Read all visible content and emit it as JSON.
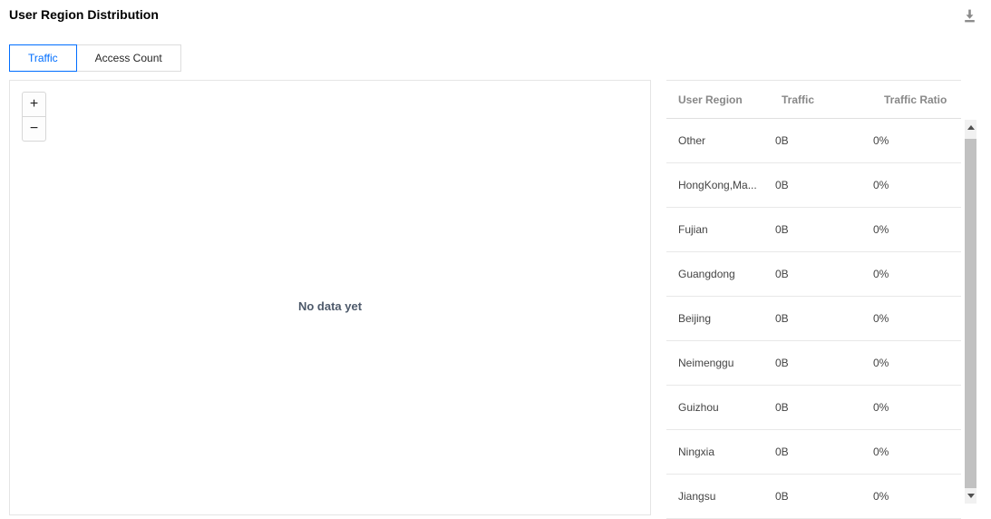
{
  "header": {
    "title": "User Region Distribution"
  },
  "tabs": [
    {
      "label": "Traffic",
      "active": true
    },
    {
      "label": "Access Count",
      "active": false
    }
  ],
  "map": {
    "zoom_in_label": "+",
    "zoom_out_label": "−",
    "empty_text": "No data yet"
  },
  "table": {
    "columns": [
      "User Region",
      "Traffic",
      "Traffic Ratio"
    ],
    "rows": [
      {
        "region": "Other",
        "traffic": "0B",
        "ratio": "0%"
      },
      {
        "region": "HongKong,Ma...",
        "traffic": "0B",
        "ratio": "0%"
      },
      {
        "region": "Fujian",
        "traffic": "0B",
        "ratio": "0%"
      },
      {
        "region": "Guangdong",
        "traffic": "0B",
        "ratio": "0%"
      },
      {
        "region": "Beijing",
        "traffic": "0B",
        "ratio": "0%"
      },
      {
        "region": "Neimenggu",
        "traffic": "0B",
        "ratio": "0%"
      },
      {
        "region": "Guizhou",
        "traffic": "0B",
        "ratio": "0%"
      },
      {
        "region": "Ningxia",
        "traffic": "0B",
        "ratio": "0%"
      },
      {
        "region": "Jiangsu",
        "traffic": "0B",
        "ratio": "0%"
      }
    ]
  },
  "icons": {
    "download": "download-icon",
    "scroll_up": "scroll-up-arrow-icon",
    "scroll_down": "scroll-down-arrow-icon"
  },
  "colors": {
    "accent_blue": "#006eff",
    "panel_border": "#e5e5e5",
    "header_text": "#888888",
    "cell_text": "#444444",
    "empty_text": "#4e5a6b",
    "scroll_thumb": "#c1c1c1",
    "icon_gray": "#8a8a8a"
  }
}
